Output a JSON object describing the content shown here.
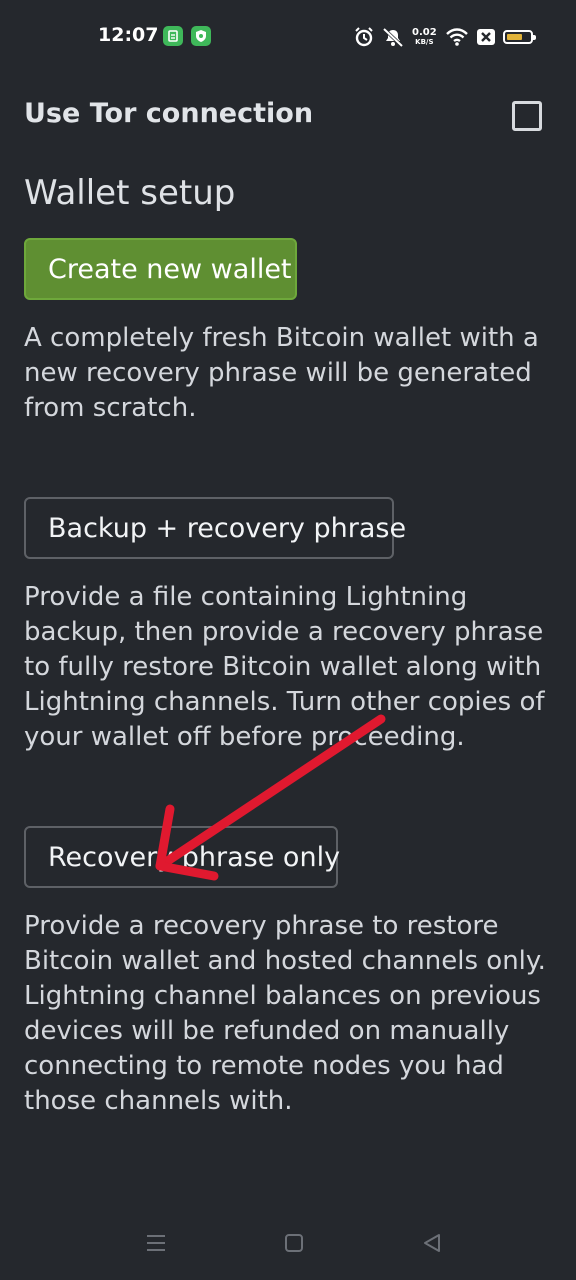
{
  "status_bar": {
    "time": "12:07",
    "net_speed_value": "0.02",
    "net_speed_unit": "KB/S",
    "battery_level": 0.7,
    "battery_color": "#e2b43a"
  },
  "tor": {
    "label": "Use Tor connection",
    "checked": false
  },
  "wallet_setup": {
    "title": "Wallet setup",
    "create": {
      "label": "Create new wallet",
      "description": "A completely fresh Bitcoin wallet with a new recovery phrase will be generated from scratch."
    },
    "backup": {
      "label": "Backup + recovery phrase",
      "description": "Provide a file containing Lightning backup, then provide a recovery phrase to fully restore Bitcoin wallet along with Lightning channels. Turn other copies of your wallet off before proceeding."
    },
    "recovery_only": {
      "label": "Recovery phrase only",
      "description": "Provide a recovery phrase to restore Bitcoin wallet and hosted channels only. Lightning channel balances on previous devices will be refunded on manually connecting to remote nodes you had those channels with."
    }
  },
  "colors": {
    "background": "#25282d",
    "primary_button": "#5f8f32",
    "annotation_arrow": "#e0192f"
  },
  "icons": {
    "status_bar": [
      "app-notification-icon",
      "shield-icon",
      "alarm-icon",
      "mute-icon",
      "wifi-icon",
      "sim-off-icon",
      "battery-icon"
    ],
    "nav_bar": [
      "menu-icon",
      "home-icon",
      "back-icon"
    ],
    "annotation": "red-arrow"
  }
}
